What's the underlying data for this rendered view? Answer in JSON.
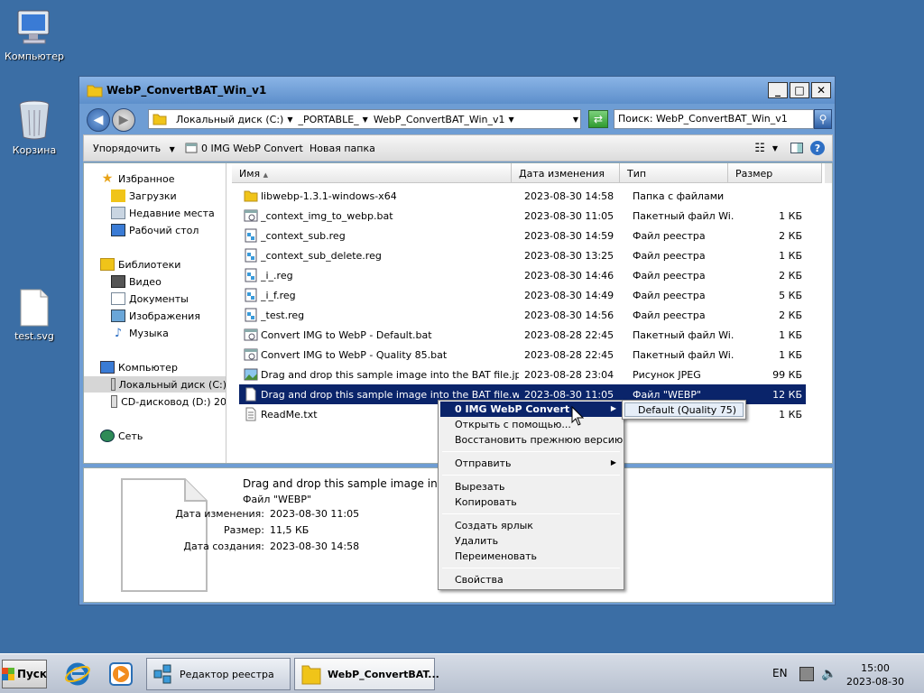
{
  "desktop": {
    "icons": [
      {
        "label": "Компьютер"
      },
      {
        "label": "Корзина"
      },
      {
        "label": "test.svg"
      }
    ]
  },
  "window": {
    "title": "WebP_ConvertBAT_Win_v1",
    "controls": {
      "minimize": "_",
      "maximize": "□",
      "close": "✕"
    }
  },
  "address": {
    "crumbs": [
      "Локальный диск (C:)",
      "_PORTABLE_",
      "WebP_ConvertBAT_Win_v1"
    ],
    "search_placeholder": "Поиск: WebP_ConvertBAT_Win_v1"
  },
  "toolbar": {
    "organize": "Упорядочить",
    "convert": "0 IMG WebP Convert",
    "new_folder": "Новая папка"
  },
  "nav": {
    "favorites": "Избранное",
    "downloads": "Загрузки",
    "recent": "Недавние места",
    "desktop": "Рабочий стол",
    "libraries": "Библиотеки",
    "video": "Видео",
    "documents": "Документы",
    "pictures": "Изображения",
    "music": "Музыка",
    "computer": "Компьютер",
    "local_disk": "Локальный диск (C:)",
    "cd_drive": "CD-дисковод (D:) 20",
    "network": "Сеть"
  },
  "columns": {
    "name": "Имя",
    "date": "Дата изменения",
    "type": "Тип",
    "size": "Размер"
  },
  "files": [
    {
      "name": "libwebp-1.3.1-windows-x64",
      "date": "2023-08-30 14:58",
      "type": "Папка с файлами",
      "size": "",
      "icon": "folder"
    },
    {
      "name": "_context_img_to_webp.bat",
      "date": "2023-08-30 11:05",
      "type": "Пакетный файл Wi...",
      "size": "1 КБ",
      "icon": "bat"
    },
    {
      "name": "_context_sub.reg",
      "date": "2023-08-30 14:59",
      "type": "Файл реестра",
      "size": "2 КБ",
      "icon": "reg"
    },
    {
      "name": "_context_sub_delete.reg",
      "date": "2023-08-30 13:25",
      "type": "Файл реестра",
      "size": "1 КБ",
      "icon": "reg"
    },
    {
      "name": "_i_.reg",
      "date": "2023-08-30 14:46",
      "type": "Файл реестра",
      "size": "2 КБ",
      "icon": "reg"
    },
    {
      "name": "_i_f.reg",
      "date": "2023-08-30 14:49",
      "type": "Файл реестра",
      "size": "5 КБ",
      "icon": "reg"
    },
    {
      "name": "_test.reg",
      "date": "2023-08-30 14:56",
      "type": "Файл реестра",
      "size": "2 КБ",
      "icon": "reg"
    },
    {
      "name": "Convert IMG to WebP - Default.bat",
      "date": "2023-08-28 22:45",
      "type": "Пакетный файл Wi...",
      "size": "1 КБ",
      "icon": "bat"
    },
    {
      "name": "Convert IMG to WebP - Quality 85.bat",
      "date": "2023-08-28 22:45",
      "type": "Пакетный файл Wi...",
      "size": "1 КБ",
      "icon": "bat"
    },
    {
      "name": "Drag and drop this sample image into the BAT file.jpg",
      "date": "2023-08-28 23:04",
      "type": "Рисунок JPEG",
      "size": "99 КБ",
      "icon": "jpg"
    },
    {
      "name": "Drag and drop this sample image into the BAT file.webp",
      "date": "2023-08-30 11:05",
      "type": "Файл \"WEBP\"",
      "size": "12 КБ",
      "icon": "blank",
      "selected": true
    },
    {
      "name": "ReadMe.txt",
      "date": "",
      "type": "",
      "size": "1 КБ",
      "icon": "txt"
    }
  ],
  "details": {
    "name": "Drag and drop this sample image into the BAT file.webp",
    "type": "Файл \"WEBP\"",
    "modified_label": "Дата изменения:",
    "modified": "2023-08-30 11:05",
    "size_label": "Размер:",
    "size": "11,5 КБ",
    "created_label": "Дата создания:",
    "created": "2023-08-30 14:58"
  },
  "context_menu": {
    "convert": "0 IMG WebP Convert",
    "open_with": "Открыть с помощью...",
    "restore": "Восстановить прежнюю версию",
    "send_to": "Отправить",
    "cut": "Вырезать",
    "copy": "Копировать",
    "shortcut": "Создать ярлык",
    "delete": "Удалить",
    "rename": "Переименовать",
    "properties": "Свойства"
  },
  "submenu": {
    "default": "Default (Quality 75)"
  },
  "taskbar": {
    "start": "Пуск",
    "regedit": "Редактор реестра",
    "explorer": "WebP_ConvertBAT...",
    "lang": "EN",
    "time": "15:00",
    "date": "2023-08-30"
  },
  "colors": {
    "desktop": "#3b6ea5",
    "selection": "#0a246a"
  }
}
